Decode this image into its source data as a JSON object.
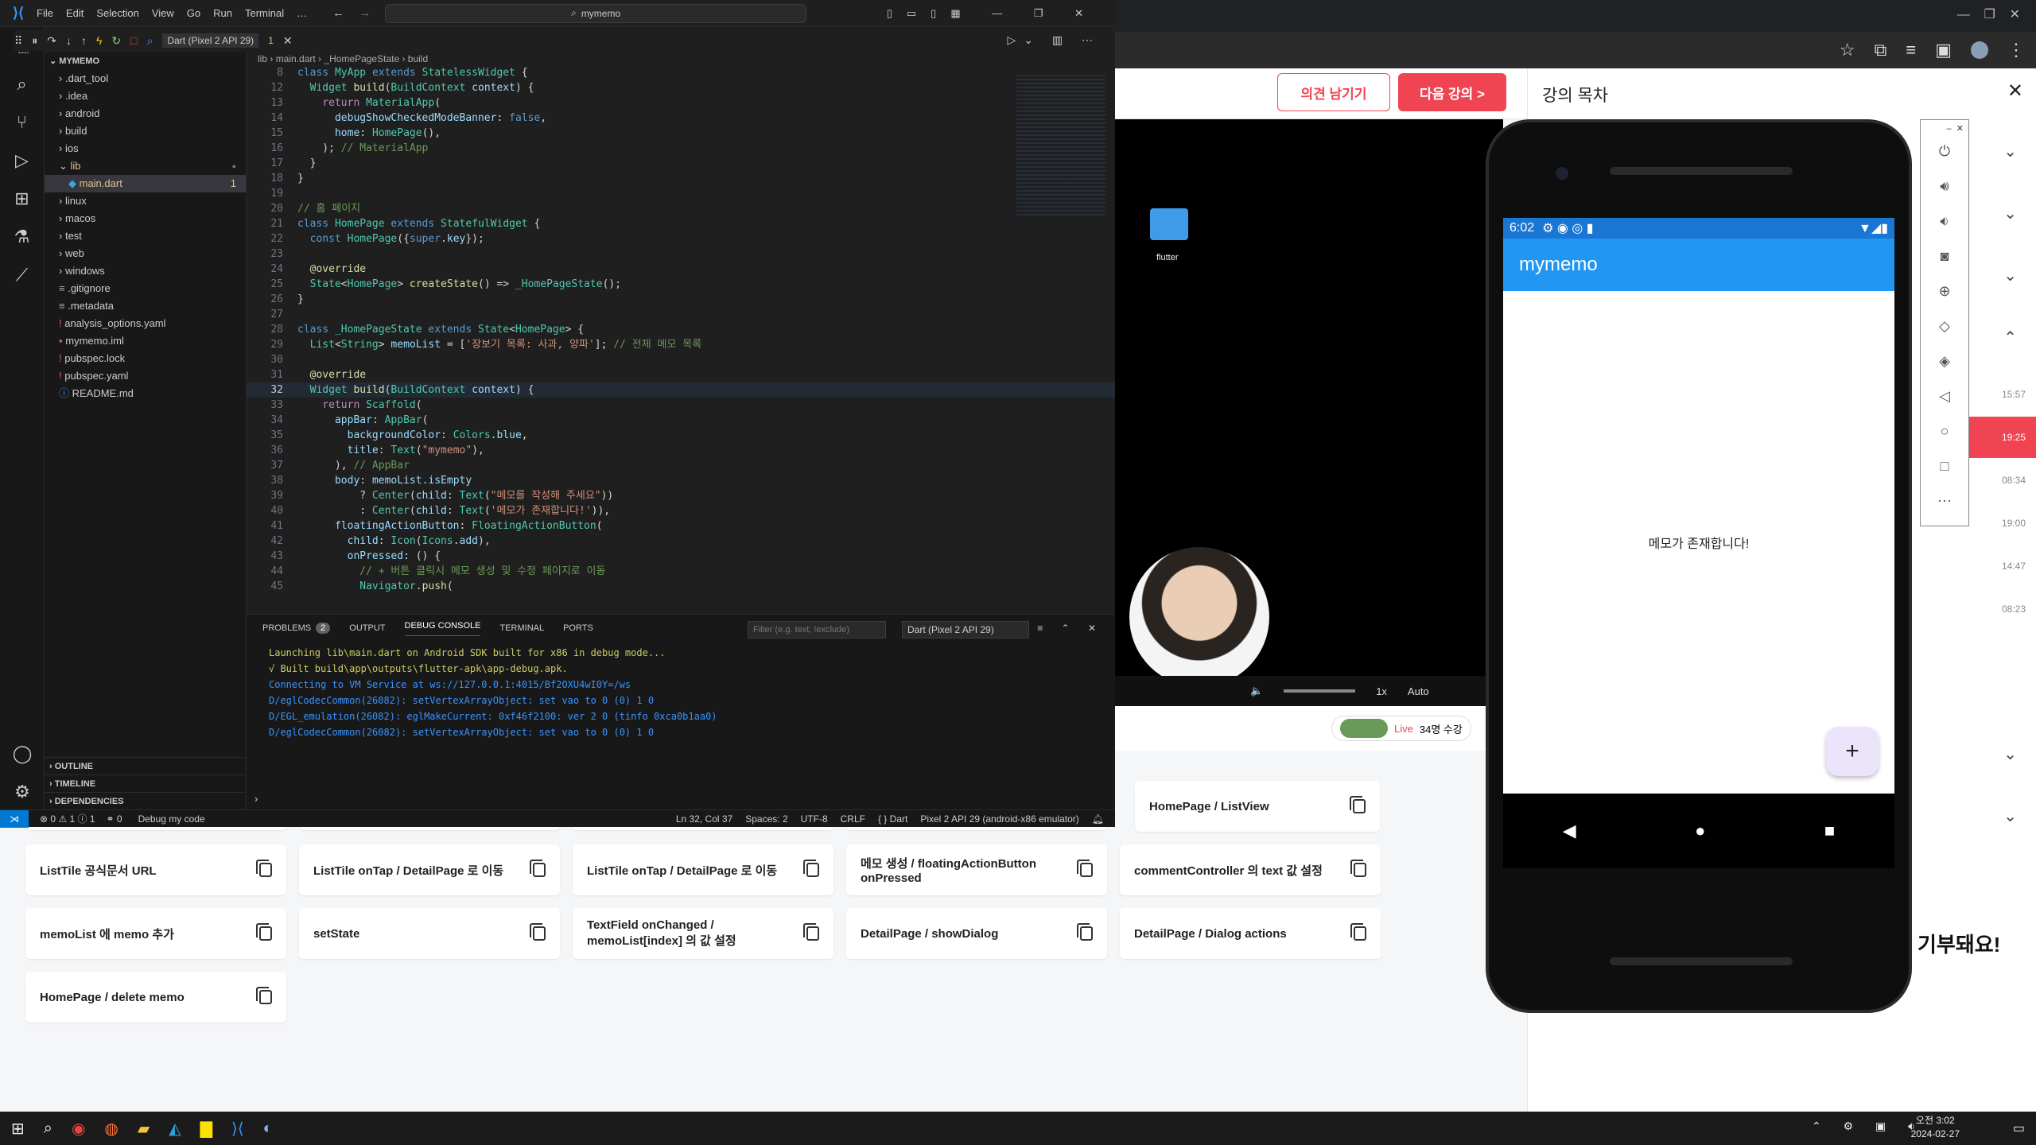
{
  "vscode": {
    "menu": [
      "File",
      "Edit",
      "Selection",
      "View",
      "Go",
      "Run",
      "Terminal",
      "…"
    ],
    "search": "mymemo",
    "device_select": "Dart (Pixel 2 API 29)",
    "debug_tab_suffix": "1",
    "breadcrumb": [
      "lib",
      "main.dart",
      "_HomePageState",
      "build"
    ],
    "explorer_title": "MYMEMO",
    "tree": [
      {
        "label": ".dart_tool",
        "kind": "folder",
        "indent": 1
      },
      {
        "label": ".idea",
        "kind": "folder",
        "indent": 1
      },
      {
        "label": "android",
        "kind": "folder",
        "indent": 1
      },
      {
        "label": "build",
        "kind": "folder",
        "indent": 1
      },
      {
        "label": "ios",
        "kind": "folder",
        "indent": 1
      },
      {
        "label": "lib",
        "kind": "folder-open",
        "indent": 1,
        "mod": true
      },
      {
        "label": "main.dart",
        "kind": "dart",
        "indent": 2,
        "badge": "1",
        "active": true
      },
      {
        "label": "linux",
        "kind": "folder",
        "indent": 1
      },
      {
        "label": "macos",
        "kind": "folder",
        "indent": 1
      },
      {
        "label": "test",
        "kind": "folder",
        "indent": 1
      },
      {
        "label": "web",
        "kind": "folder",
        "indent": 1
      },
      {
        "label": "windows",
        "kind": "folder",
        "indent": 1
      },
      {
        "label": ".gitignore",
        "kind": "file",
        "indent": 1
      },
      {
        "label": ".metadata",
        "kind": "file",
        "indent": 1
      },
      {
        "label": "analysis_options.yaml",
        "kind": "yaml",
        "indent": 1
      },
      {
        "label": "mymemo.iml",
        "kind": "iml",
        "indent": 1
      },
      {
        "label": "pubspec.lock",
        "kind": "lock",
        "indent": 1
      },
      {
        "label": "pubspec.yaml",
        "kind": "yaml",
        "indent": 1
      },
      {
        "label": "README.md",
        "kind": "md",
        "indent": 1
      }
    ],
    "sections": [
      "OUTLINE",
      "TIMELINE",
      "DEPENDENCIES"
    ],
    "code": [
      {
        "n": "8",
        "t": [
          [
            "kw",
            "class "
          ],
          [
            "ty",
            "MyApp "
          ],
          [
            "kw",
            "extends "
          ],
          [
            "ty",
            "StatelessWidget "
          ],
          [
            "pu",
            "{"
          ]
        ]
      },
      {
        "n": "12",
        "t": [
          [
            "pu",
            "  "
          ],
          [
            "ty",
            "Widget "
          ],
          [
            "fn",
            "build"
          ],
          [
            "pu",
            "("
          ],
          [
            "ty",
            "BuildContext "
          ],
          [
            "va",
            "context"
          ],
          [
            "pu",
            ") {"
          ]
        ]
      },
      {
        "n": "13",
        "t": [
          [
            "pu",
            "    "
          ],
          [
            "ctl",
            "return "
          ],
          [
            "ty",
            "MaterialApp"
          ],
          [
            "pu",
            "("
          ]
        ]
      },
      {
        "n": "14",
        "t": [
          [
            "pu",
            "      "
          ],
          [
            "va",
            "debugShowCheckedModeBanner"
          ],
          [
            "pu",
            ": "
          ],
          [
            "kw",
            "false"
          ],
          [
            "pu",
            ","
          ]
        ]
      },
      {
        "n": "15",
        "t": [
          [
            "pu",
            "      "
          ],
          [
            "va",
            "home"
          ],
          [
            "pu",
            ": "
          ],
          [
            "ty",
            "HomePage"
          ],
          [
            "pu",
            "(),"
          ]
        ]
      },
      {
        "n": "16",
        "t": [
          [
            "pu",
            "    ); "
          ],
          [
            "cm",
            "// MaterialApp"
          ]
        ]
      },
      {
        "n": "17",
        "t": [
          [
            "pu",
            "  }"
          ]
        ]
      },
      {
        "n": "18",
        "t": [
          [
            "pu",
            "}"
          ]
        ]
      },
      {
        "n": "19",
        "t": [
          [
            "pu",
            ""
          ]
        ]
      },
      {
        "n": "20",
        "t": [
          [
            "cm",
            "// 홈 페이지"
          ]
        ]
      },
      {
        "n": "21",
        "t": [
          [
            "kw",
            "class "
          ],
          [
            "ty",
            "HomePage "
          ],
          [
            "kw",
            "extends "
          ],
          [
            "ty",
            "StatefulWidget "
          ],
          [
            "pu",
            "{"
          ]
        ]
      },
      {
        "n": "22",
        "t": [
          [
            "pu",
            "  "
          ],
          [
            "kw",
            "const "
          ],
          [
            "ty",
            "HomePage"
          ],
          [
            "pu",
            "({"
          ],
          [
            "kw",
            "super"
          ],
          [
            "pu",
            "."
          ],
          [
            "va",
            "key"
          ],
          [
            "pu",
            "});"
          ]
        ]
      },
      {
        "n": "23",
        "t": [
          [
            "pu",
            ""
          ]
        ]
      },
      {
        "n": "24",
        "t": [
          [
            "pu",
            "  "
          ],
          [
            "fn",
            "@override"
          ]
        ]
      },
      {
        "n": "25",
        "t": [
          [
            "pu",
            "  "
          ],
          [
            "ty",
            "State"
          ],
          [
            "pu",
            "<"
          ],
          [
            "ty",
            "HomePage"
          ],
          [
            "pu",
            "> "
          ],
          [
            "fn",
            "createState"
          ],
          [
            "pu",
            "() => "
          ],
          [
            "ty",
            "_HomePageState"
          ],
          [
            "pu",
            "();"
          ]
        ]
      },
      {
        "n": "26",
        "t": [
          [
            "pu",
            "}"
          ]
        ]
      },
      {
        "n": "27",
        "t": [
          [
            "pu",
            ""
          ]
        ]
      },
      {
        "n": "28",
        "t": [
          [
            "kw",
            "class "
          ],
          [
            "ty",
            "_HomePageState "
          ],
          [
            "kw",
            "extends "
          ],
          [
            "ty",
            "State"
          ],
          [
            "pu",
            "<"
          ],
          [
            "ty",
            "HomePage"
          ],
          [
            "pu",
            "> {"
          ]
        ]
      },
      {
        "n": "29",
        "t": [
          [
            "pu",
            "  "
          ],
          [
            "ty",
            "List"
          ],
          [
            "pu",
            "<"
          ],
          [
            "ty",
            "String"
          ],
          [
            "pu",
            "> "
          ],
          [
            "va",
            "memoList"
          ],
          [
            "pu",
            " = ["
          ],
          [
            "st",
            "'장보기 목록: 사과, 양파'"
          ],
          [
            "pu",
            "]; "
          ],
          [
            "cm",
            "// 전체 메모 목록"
          ]
        ]
      },
      {
        "n": "30",
        "t": [
          [
            "pu",
            ""
          ]
        ]
      },
      {
        "n": "31",
        "t": [
          [
            "pu",
            "  "
          ],
          [
            "fn",
            "@override"
          ]
        ]
      },
      {
        "n": "32",
        "t": [
          [
            "pu",
            "  "
          ],
          [
            "ty",
            "Widget "
          ],
          [
            "fn",
            "build"
          ],
          [
            "pu",
            "("
          ],
          [
            "ty",
            "BuildContext "
          ],
          [
            "va",
            "context"
          ],
          [
            "pu",
            ") {"
          ]
        ]
      },
      {
        "n": "33",
        "t": [
          [
            "pu",
            "    "
          ],
          [
            "ctl",
            "return "
          ],
          [
            "ty",
            "Scaffold"
          ],
          [
            "pu",
            "("
          ]
        ]
      },
      {
        "n": "34",
        "t": [
          [
            "pu",
            "      "
          ],
          [
            "va",
            "appBar"
          ],
          [
            "pu",
            ": "
          ],
          [
            "ty",
            "AppBar"
          ],
          [
            "pu",
            "("
          ]
        ]
      },
      {
        "n": "35",
        "t": [
          [
            "pu",
            "        "
          ],
          [
            "va",
            "backgroundColor"
          ],
          [
            "pu",
            ": "
          ],
          [
            "ty",
            "Colors"
          ],
          [
            "pu",
            "."
          ],
          [
            "va",
            "blue"
          ],
          [
            "pu",
            ","
          ]
        ]
      },
      {
        "n": "36",
        "t": [
          [
            "pu",
            "        "
          ],
          [
            "va",
            "title"
          ],
          [
            "pu",
            ": "
          ],
          [
            "ty",
            "Text"
          ],
          [
            "pu",
            "("
          ],
          [
            "st",
            "\"mymemo\""
          ],
          [
            "pu",
            "),"
          ]
        ]
      },
      {
        "n": "37",
        "t": [
          [
            "pu",
            "      ), "
          ],
          [
            "cm",
            "// AppBar"
          ]
        ]
      },
      {
        "n": "38",
        "t": [
          [
            "pu",
            "      "
          ],
          [
            "va",
            "body"
          ],
          [
            "pu",
            ": "
          ],
          [
            "va",
            "memoList"
          ],
          [
            "pu",
            "."
          ],
          [
            "va",
            "isEmpty"
          ]
        ]
      },
      {
        "n": "39",
        "t": [
          [
            "pu",
            "          ? "
          ],
          [
            "ty",
            "Center"
          ],
          [
            "pu",
            "("
          ],
          [
            "va",
            "child"
          ],
          [
            "pu",
            ": "
          ],
          [
            "ty",
            "Text"
          ],
          [
            "pu",
            "("
          ],
          [
            "st",
            "\"메모를 작성해 주세요\""
          ],
          [
            "pu",
            "))"
          ]
        ]
      },
      {
        "n": "40",
        "t": [
          [
            "pu",
            "          : "
          ],
          [
            "ty",
            "Center"
          ],
          [
            "pu",
            "("
          ],
          [
            "va",
            "child"
          ],
          [
            "pu",
            ": "
          ],
          [
            "ty",
            "Text"
          ],
          [
            "pu",
            "("
          ],
          [
            "st",
            "'메모가 존재합니다!'"
          ],
          [
            "pu",
            ")),"
          ]
        ]
      },
      {
        "n": "41",
        "t": [
          [
            "pu",
            "      "
          ],
          [
            "va",
            "floatingActionButton"
          ],
          [
            "pu",
            ": "
          ],
          [
            "ty",
            "FloatingActionButton"
          ],
          [
            "pu",
            "("
          ]
        ]
      },
      {
        "n": "42",
        "t": [
          [
            "pu",
            "        "
          ],
          [
            "va",
            "child"
          ],
          [
            "pu",
            ": "
          ],
          [
            "ty",
            "Icon"
          ],
          [
            "pu",
            "("
          ],
          [
            "ty",
            "Icons"
          ],
          [
            "pu",
            "."
          ],
          [
            "va",
            "add"
          ],
          [
            "pu",
            "),"
          ]
        ]
      },
      {
        "n": "43",
        "t": [
          [
            "pu",
            "        "
          ],
          [
            "va",
            "onPressed"
          ],
          [
            "pu",
            ": () {"
          ]
        ]
      },
      {
        "n": "44",
        "t": [
          [
            "pu",
            "          "
          ],
          [
            "cm",
            "// + 버튼 클릭시 메모 생성 및 수정 페이지로 이동"
          ]
        ]
      },
      {
        "n": "45",
        "t": [
          [
            "pu",
            "          "
          ],
          [
            "ty",
            "Navigator"
          ],
          [
            "pu",
            "."
          ],
          [
            "fn",
            "push"
          ],
          [
            "pu",
            "("
          ]
        ]
      }
    ],
    "panel_tabs": [
      "PROBLEMS",
      "OUTPUT",
      "DEBUG CONSOLE",
      "TERMINAL",
      "PORTS"
    ],
    "problems_count": "2",
    "filter_placeholder": "Filter (e.g. text, !exclude)",
    "console_select": "Dart (Pixel 2 API 29)",
    "console": [
      {
        "c": "#cccc66",
        "t": "Launching lib\\main.dart on Android SDK built for x86 in debug mode..."
      },
      {
        "c": "#cccc66",
        "t": "√  Built build\\app\\outputs\\flutter-apk\\app-debug.apk."
      },
      {
        "c": "#3794ff",
        "t": "Connecting to VM Service at ws://127.0.0.1:4015/Bf2OXU4wI0Y=/ws"
      },
      {
        "c": "#3794ff",
        "t": "D/eglCodecCommon(26082): setVertexArrayObject: set vao to 0 (0) 1 0"
      },
      {
        "c": "#3794ff",
        "t": "D/EGL_emulation(26082): eglMakeCurrent: 0xf46f2100: ver 2 0 (tinfo 0xca0b1aa0)"
      },
      {
        "c": "#3794ff",
        "t": "D/eglCodecCommon(26082): setVertexArrayObject: set vao to 0 (0) 1 0"
      }
    ],
    "status": {
      "errors": "⊗ 0 ⚠ 1 ⓘ 1",
      "ports": "⚭ 0",
      "debug": "Debug my code",
      "pos": "Ln 32, Col 37",
      "spaces": "Spaces: 2",
      "enc": "UTF-8",
      "eol": "CRLF",
      "lang": "{ } Dart",
      "device": "Pixel 2 API 29 (android-x86 emulator)"
    }
  },
  "lecture": {
    "feedback_btn": "의견 남기기",
    "next_btn": "다음 강의 >",
    "toc_title": "강의 목차",
    "folder_label": "flutter",
    "video": {
      "speed": "1x",
      "quality": "Auto"
    },
    "live": "Live",
    "live_viewers": "34명 수강",
    "toc_times": [
      "15:57",
      "19:25",
      "08:34",
      "19:00",
      "14:47",
      "08:23"
    ],
    "donate": "기부돼요!"
  },
  "cards": [
    {
      "label": "HomePage / ListView"
    },
    {
      "label": "ListTile 공식문서 URL"
    },
    {
      "label": "ListTile onTap / DetailPage 로 이동"
    },
    {
      "label": "ListTile onTap / DetailPage 로 이동"
    },
    {
      "label": "메모 생성 / floatingActionButton onPressed"
    },
    {
      "label": "commentController 의 text 값 설정"
    },
    {
      "label": "memoList 에 memo 추가"
    },
    {
      "label": "setState"
    },
    {
      "label": "TextField onChanged / memoList[index] 의 값 설정"
    },
    {
      "label": "DetailPage / showDialog"
    },
    {
      "label": "DetailPage / Dialog actions"
    },
    {
      "label": "HomePage / delete memo"
    }
  ],
  "phone": {
    "time": "6:02",
    "app_title": "mymemo",
    "body": "메모가 존재합니다!",
    "fab": "+",
    "appbar_color": "#2196f3"
  },
  "taskbar": {
    "ampm": "오전 3:02",
    "date": "2024-02-27"
  }
}
